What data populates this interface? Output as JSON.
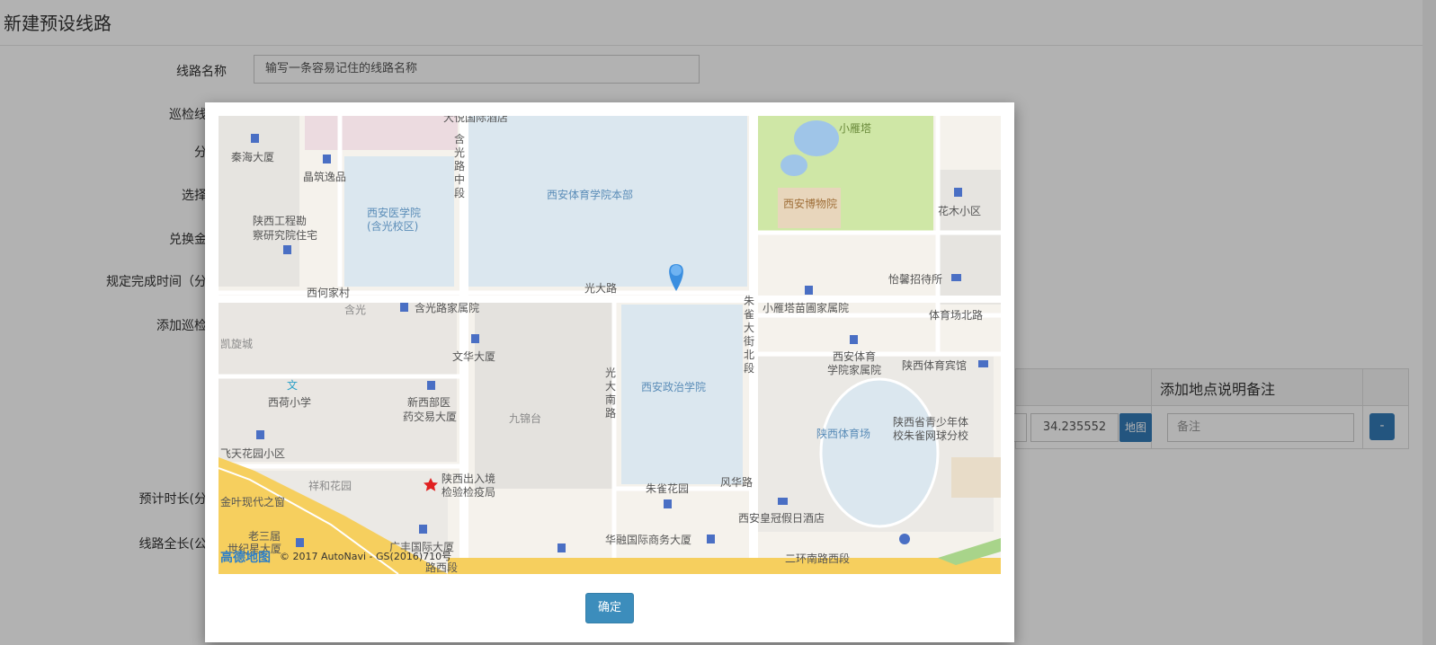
{
  "page": {
    "title": "新建预设线路",
    "labels": {
      "route_name": "线路名称",
      "patrol": "巡检线",
      "branch": "分",
      "select": "选择",
      "exchange": "兑换金",
      "deadline": "规定完成时间（分",
      "add_point": "添加巡检",
      "est_duration": "预计时长(分",
      "total_length": "线路全长(公"
    },
    "route_name_placeholder": "输写一条容易记住的线路名称"
  },
  "table": {
    "note_header": "添加地点说明备注",
    "latitude": "34.235552",
    "map_button": "地图",
    "note_placeholder": "备注",
    "remove_button": "-"
  },
  "modal": {
    "confirm_button": "确定",
    "map": {
      "logo": "高德地图",
      "copyright": "© 2017 AutoNavi - GS(2016)710号",
      "roads": {
        "guangda": "光大路",
        "hanguang": "含光",
        "hanguang_vertical": "含光路中段",
        "zhuque_vertical": "朱雀大街北段",
        "guangda_vertical": "光大南路",
        "fenghua": "风华路",
        "erhuan": "二环南路西段",
        "tiyuchang": "体育场北路",
        "lower_road": "路西段"
      },
      "places": [
        "西安体育学院本部",
        "西安医学院(含光校区)",
        "西安政治学院",
        "陕西体育场",
        "小雁塔",
        "西安博物院",
        "秦海大厦",
        "晶筑逸品",
        "陕西工程勘察研究院住宅",
        "西何家村",
        "含光路家属院",
        "文华大厦",
        "西荷小学",
        "新西部医药交易大厦",
        "九锦台",
        "凯旋城",
        "飞天花园小区",
        "祥和花园",
        "陕西出入境检验检疫局",
        "金叶现代之窗",
        "老三届世纪星大厦",
        "广丰国际大厦",
        "朱雀花园",
        "华融国际商务大厦",
        "西安皇冠假日酒店",
        "小雁塔苗圃家属院",
        "西安体育学院家属院",
        "陕西体育宾馆",
        "陕西省青少年体校朱雀网球分校",
        "怡馨招待所",
        "花木小区",
        "大悦国际酒店"
      ]
    }
  },
  "colors": {
    "accent": "#3c8dbc",
    "primary": "#337ab7",
    "map_block_blue": "#dbe7ef",
    "map_green": "#cfe7a6",
    "map_ground": "#f5f2ec",
    "road_yellow": "#f6cf5e"
  }
}
